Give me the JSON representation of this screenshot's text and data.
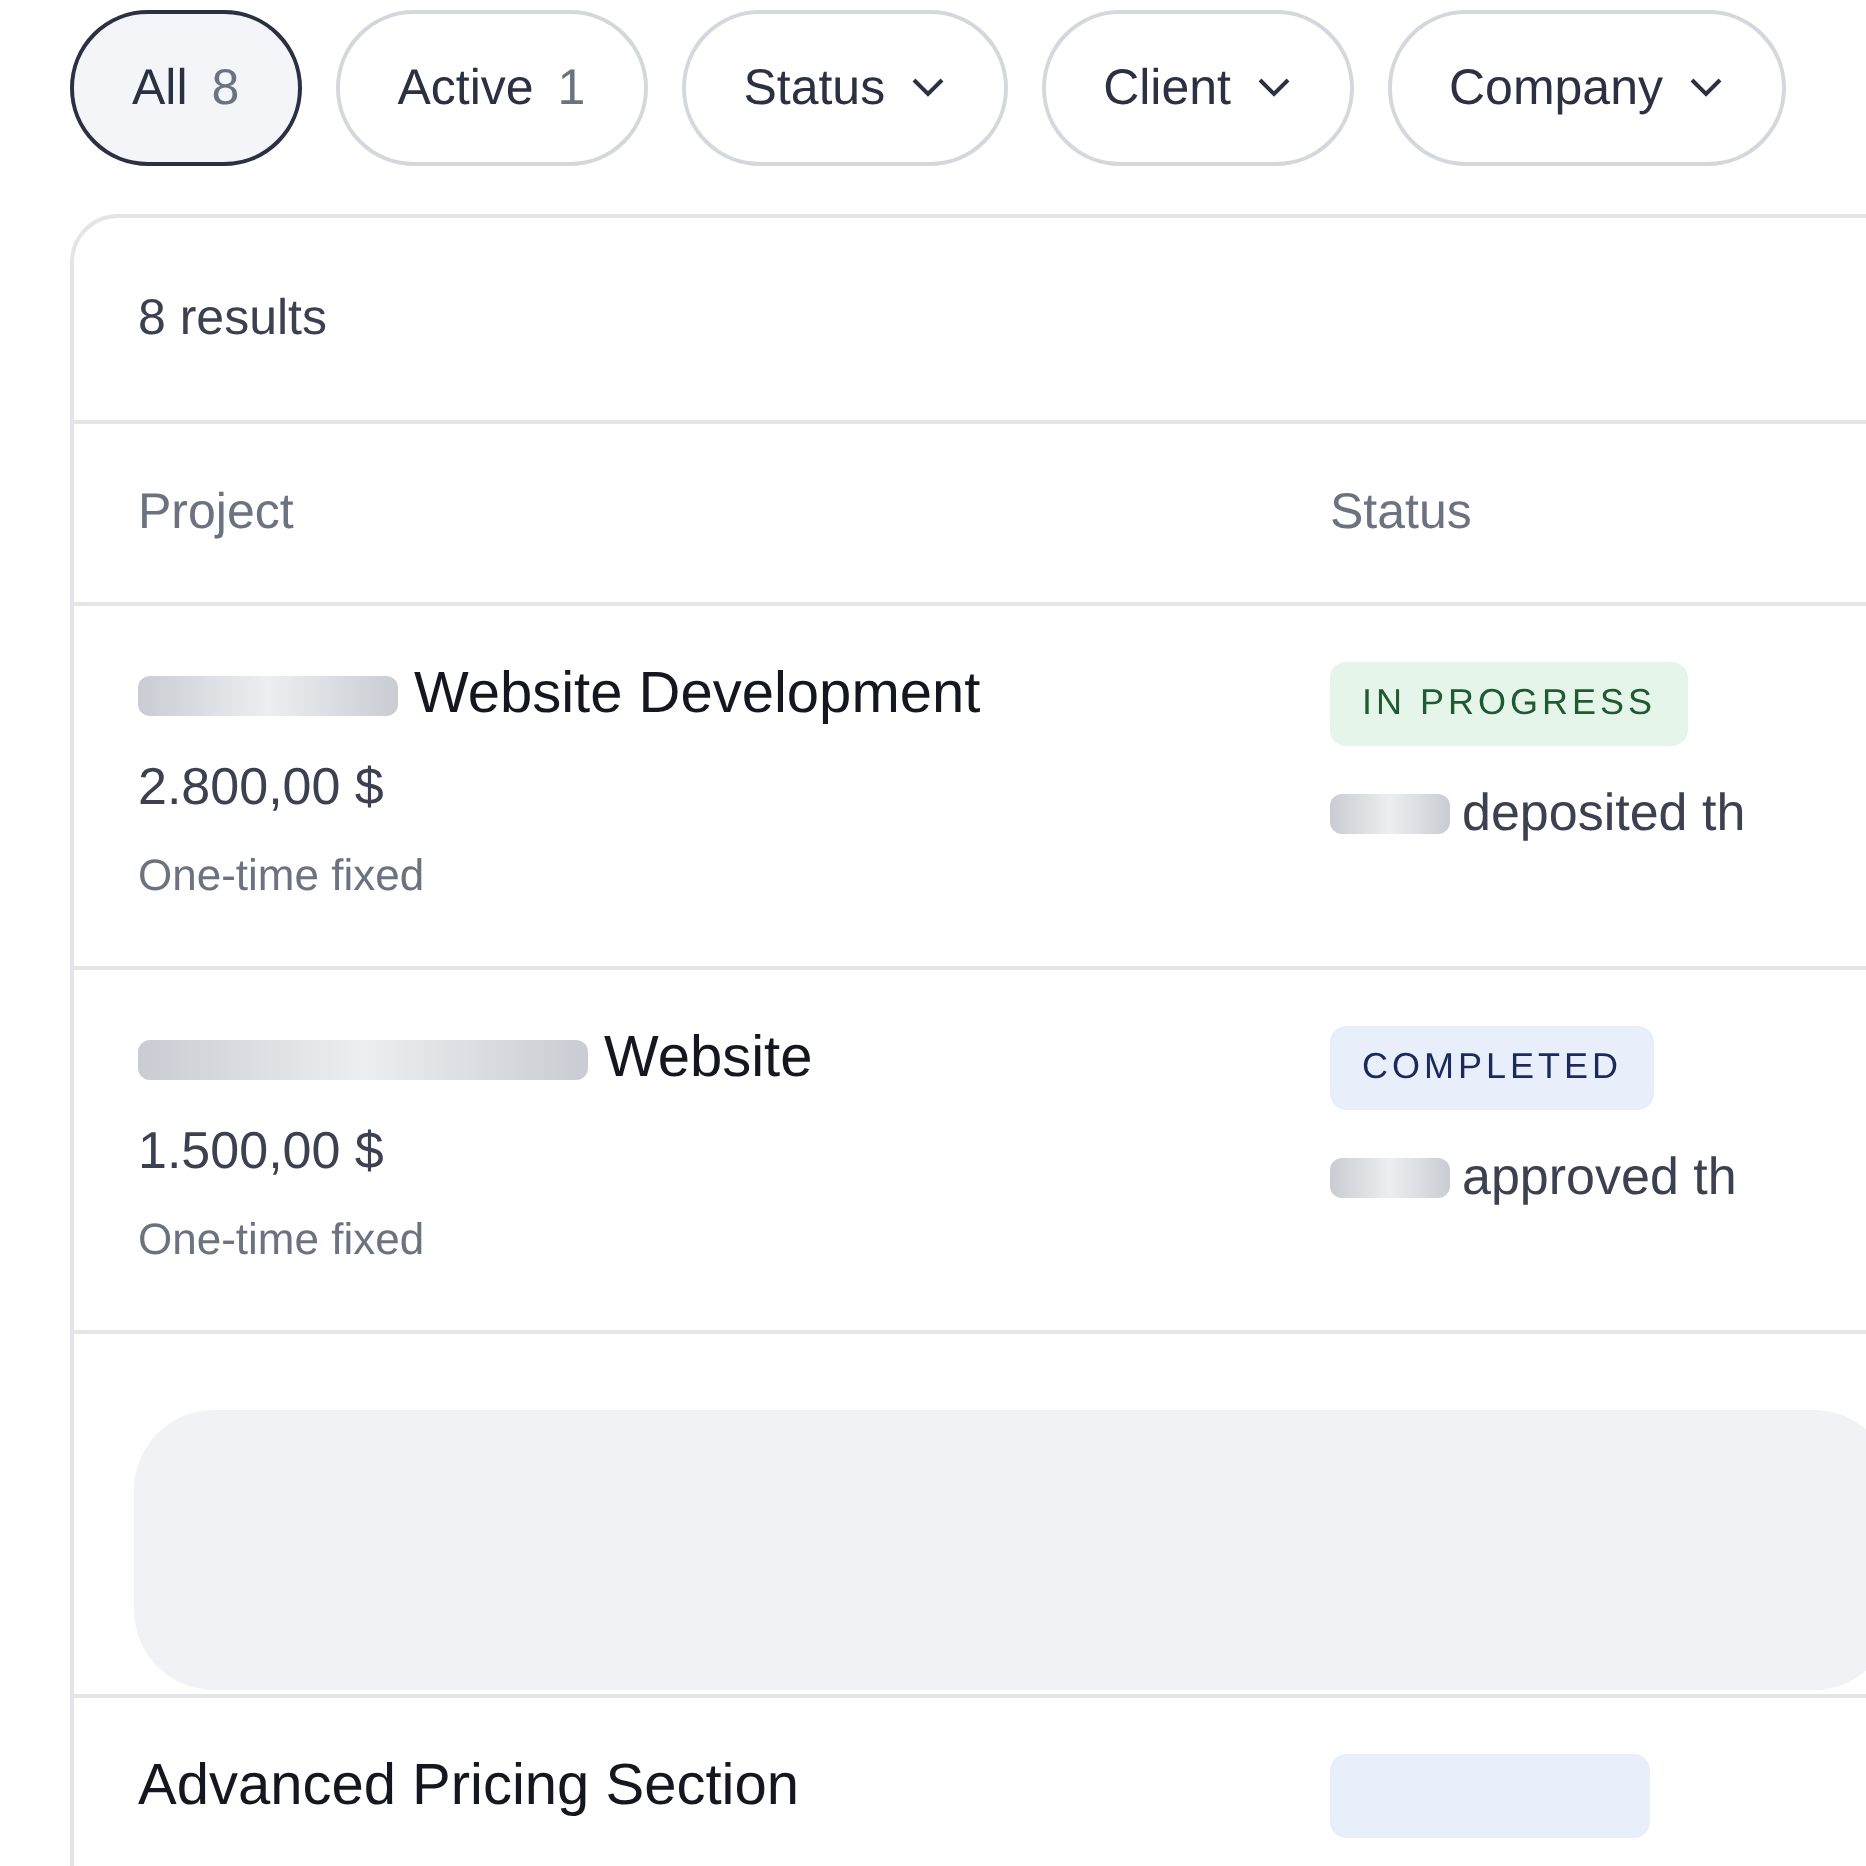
{
  "filters": [
    {
      "kind": "count",
      "label": "All",
      "count": "8",
      "selected": true
    },
    {
      "kind": "count",
      "label": "Active",
      "count": "1",
      "selected": false
    },
    {
      "kind": "dropdown",
      "label": "Status",
      "selected": false
    },
    {
      "kind": "dropdown",
      "label": "Client",
      "selected": false
    },
    {
      "kind": "dropdown",
      "label": "Company",
      "selected": false
    }
  ],
  "result_count": "8 results",
  "columns": [
    "Project",
    "Status"
  ],
  "rows": [
    {
      "kind": "project",
      "name_redacted": true,
      "name": "Website Development",
      "price": "2.800,00 $",
      "billing": "One-time fixed",
      "status": {
        "kind": "in_progress",
        "label": "IN PROGRESS"
      },
      "activity_redacted": true,
      "activity": "deposited th"
    },
    {
      "kind": "project",
      "name_redacted": true,
      "name": "Website",
      "price": "1.500,00 $",
      "billing": "One-time fixed",
      "status": {
        "kind": "completed",
        "label": "COMPLETED"
      },
      "activity_redacted": true,
      "activity": "approved th"
    },
    {
      "kind": "redacted"
    },
    {
      "kind": "project",
      "name_redacted": false,
      "name": "Advanced Pricing Section",
      "status": {
        "kind": "completed"
      }
    }
  ]
}
